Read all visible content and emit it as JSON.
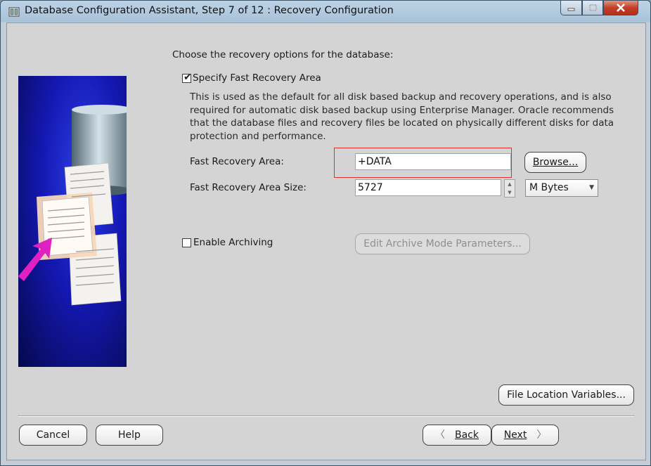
{
  "window": {
    "title": "Database Configuration Assistant, Step 7 of 12 : Recovery Configuration"
  },
  "main": {
    "prompt": "Choose the recovery options for the database:",
    "specify_fra": {
      "label": "Specify Fast Recovery Area",
      "checked": true
    },
    "description": "This is used as the default for all disk based backup and recovery operations, and is also required for automatic disk based backup using Enterprise Manager. Oracle recommends that the database files and recovery files be located on physically different disks for data protection and performance.",
    "fra_location": {
      "label": "Fast Recovery Area:",
      "value": "+DATA"
    },
    "browse_label": "Browse...",
    "fra_size": {
      "label": "Fast Recovery Area Size:",
      "value": "5727",
      "unit": "M Bytes"
    },
    "enable_archiving": {
      "label": "Enable Archiving",
      "checked": false
    },
    "edit_archive_label": "Edit Archive Mode Parameters...",
    "file_location_label": "File Location Variables..."
  },
  "footer": {
    "cancel": "Cancel",
    "help": "Help",
    "back": "Back",
    "next": "Next"
  },
  "colors": {
    "highlight": "#e23030",
    "close_button": "#c0402a",
    "side_image_blue": "#1418b2",
    "arrow_pink": "#e020c0"
  }
}
